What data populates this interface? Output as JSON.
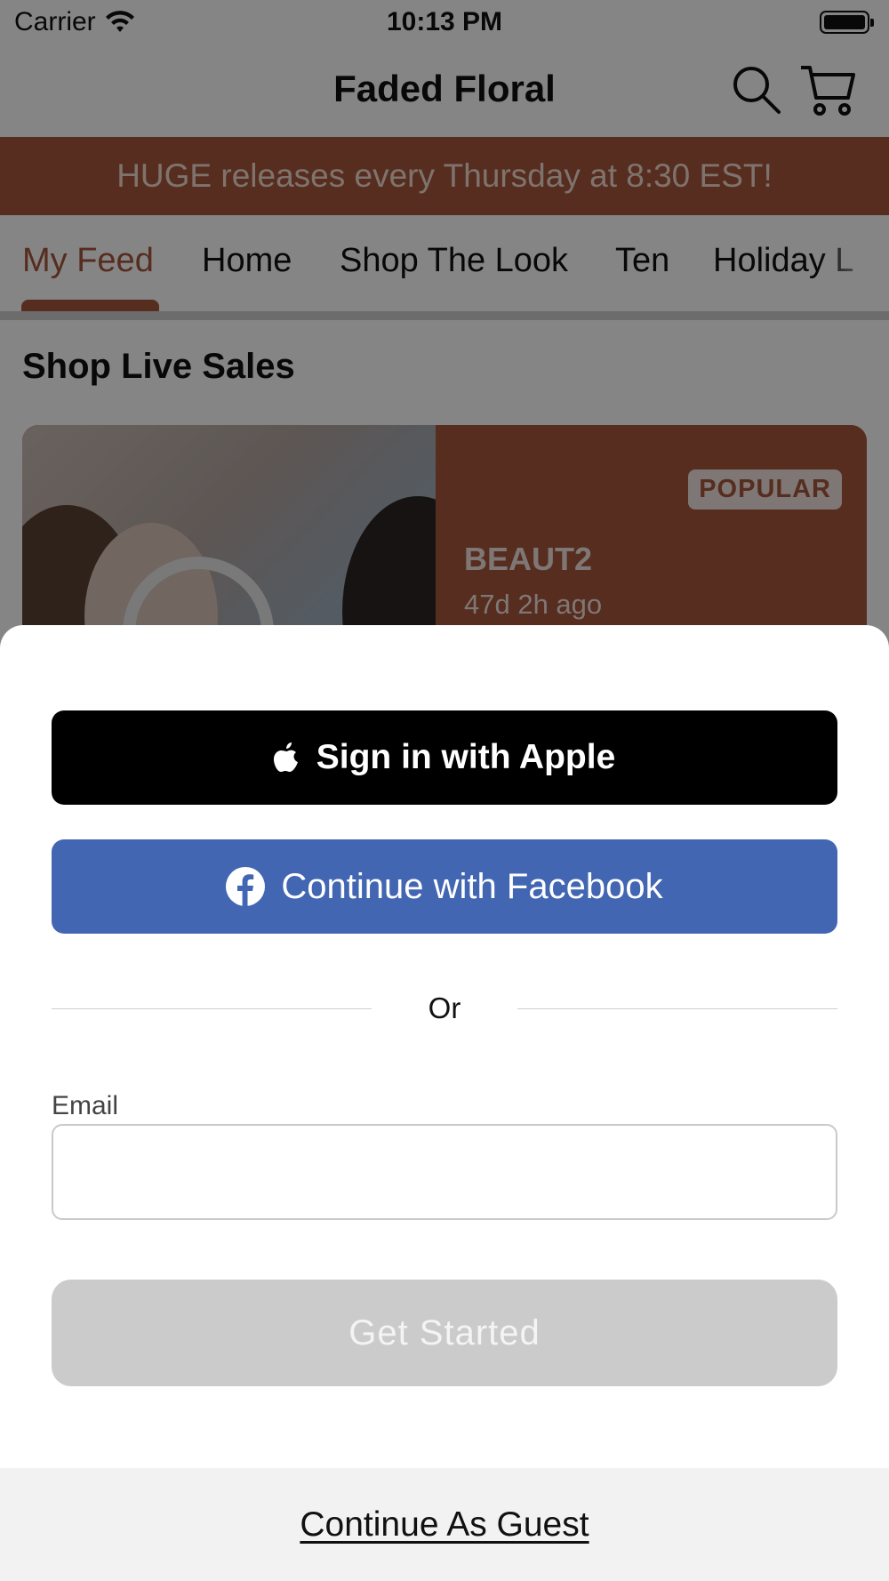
{
  "status_bar": {
    "carrier": "Carrier",
    "time": "10:13 PM"
  },
  "header": {
    "title": "Faded Floral",
    "search_icon": "search-icon",
    "cart_icon": "cart-icon"
  },
  "promo_banner": {
    "text": "HUGE releases every Thursday at 8:30 EST!"
  },
  "tabs": [
    {
      "label": "My Feed",
      "active": true
    },
    {
      "label": "Home"
    },
    {
      "label": "Shop The Look"
    },
    {
      "label": "Ten"
    },
    {
      "label": "Holiday L"
    }
  ],
  "section": {
    "title": "Shop Live Sales"
  },
  "live_sale": {
    "badge": "POPULAR",
    "name": "BEAUT2",
    "ago": "47d 2h ago"
  },
  "sheet": {
    "apple_button": "Sign in with Apple",
    "facebook_button": "Continue with Facebook",
    "divider_text": "Or",
    "email_label": "Email",
    "email_value": "",
    "email_placeholder": "",
    "get_started": "Get Started",
    "guest_link": "Continue As Guest"
  },
  "colors": {
    "brand": "#a6573a",
    "facebook": "#4266b2",
    "apple": "#000000",
    "disabled_button": "#cbcbcb"
  }
}
